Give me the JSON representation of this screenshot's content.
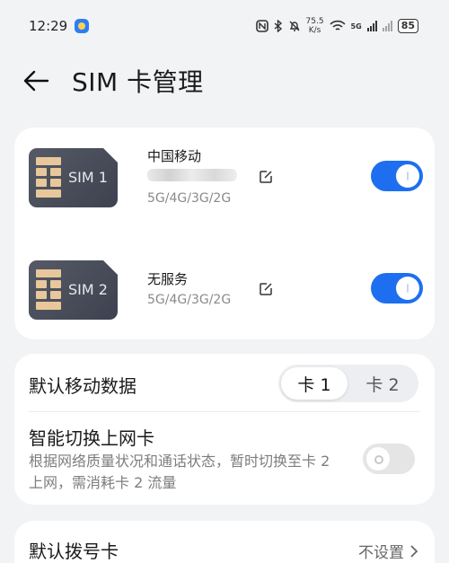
{
  "status_bar": {
    "time": "12:29",
    "net_speed_value": "75.5",
    "net_speed_unit": "K/s",
    "signal_label": "5G",
    "battery": "85",
    "icons": [
      "nfc-icon",
      "bluetooth-icon",
      "mute-icon",
      "wifi-icon",
      "signal-icon",
      "battery-icon"
    ]
  },
  "header": {
    "title": "SIM 卡管理",
    "back_icon": "arrow-left-icon"
  },
  "sims": [
    {
      "chip_label": "SIM 1",
      "carrier": "中国移动",
      "network_types": "5G/4G/3G/2G",
      "enabled": true
    },
    {
      "chip_label": "SIM 2",
      "carrier": "无服务",
      "network_types": "5G/4G/3G/2G",
      "enabled": true
    }
  ],
  "default_data": {
    "label": "默认移动数据",
    "options": [
      "卡 1",
      "卡 2"
    ],
    "selected": "卡 1"
  },
  "smart_switch": {
    "label": "智能切换上网卡",
    "description": "根据网络质量状况和通话状态，暂时切换至卡 2 上网，需消耗卡 2 流量",
    "enabled": false
  },
  "default_dial": {
    "label": "默认拨号卡",
    "value": "不设置"
  },
  "colors": {
    "accent": "#1e6ff0",
    "background": "#f1f3f5",
    "card": "#ffffff"
  }
}
